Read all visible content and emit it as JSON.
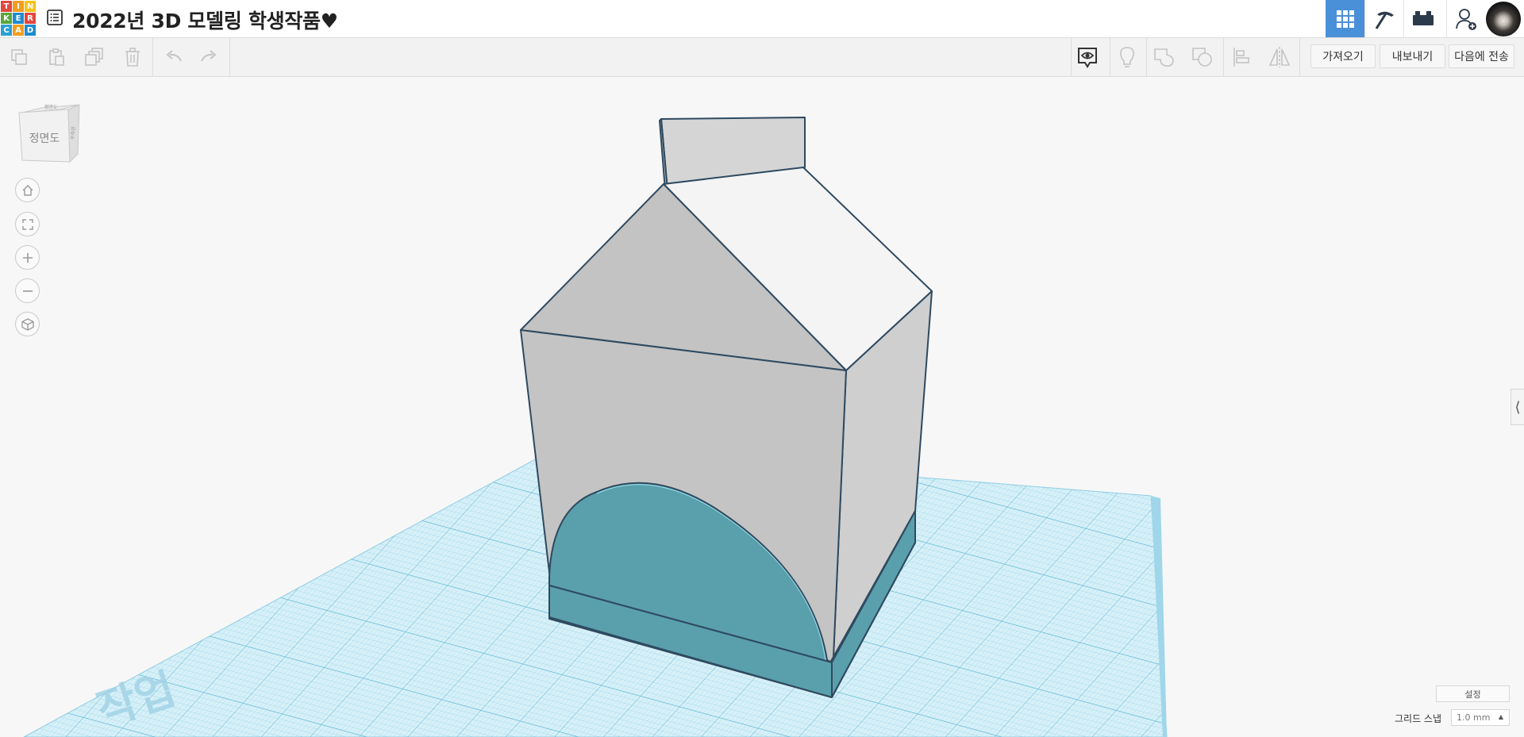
{
  "header": {
    "logo_letters": [
      "T",
      "I",
      "N",
      "K",
      "E",
      "R",
      "C",
      "A",
      "D"
    ],
    "title": "2022년 3D 모델링 학생작품♥",
    "icons": [
      "grid-view-icon",
      "pickaxe-icon",
      "bricks-icon",
      "add-user-icon"
    ]
  },
  "toolbar": {
    "left_icons": [
      "copy-icon",
      "paste-icon",
      "duplicate-icon",
      "delete-icon",
      "undo-icon",
      "redo-icon"
    ],
    "right_icons": [
      "show-hidden-icon",
      "bulb-icon",
      "group-icon",
      "ungroup-icon",
      "align-icon",
      "mirror-icon"
    ],
    "import_label": "가져오기",
    "export_label": "내보내기",
    "send_to_label": "다음에 전송"
  },
  "viewport": {
    "view_cube_label": "정면도",
    "view_cube_top_label": "평면도",
    "view_cube_side_label": "우측면",
    "nav_buttons": [
      "home-view",
      "fit-all",
      "zoom-in",
      "zoom-out",
      "perspective-toggle"
    ],
    "workplane_watermark": "작업",
    "accent_grid_color": "#7fc8df",
    "shape_color": "#c4c4c4",
    "hole_color": "#5aa1ad"
  },
  "bottom_right": {
    "settings_label": "설정",
    "grid_snap_label": "그리드 스냅",
    "grid_snap_value": "1.0 mm"
  }
}
